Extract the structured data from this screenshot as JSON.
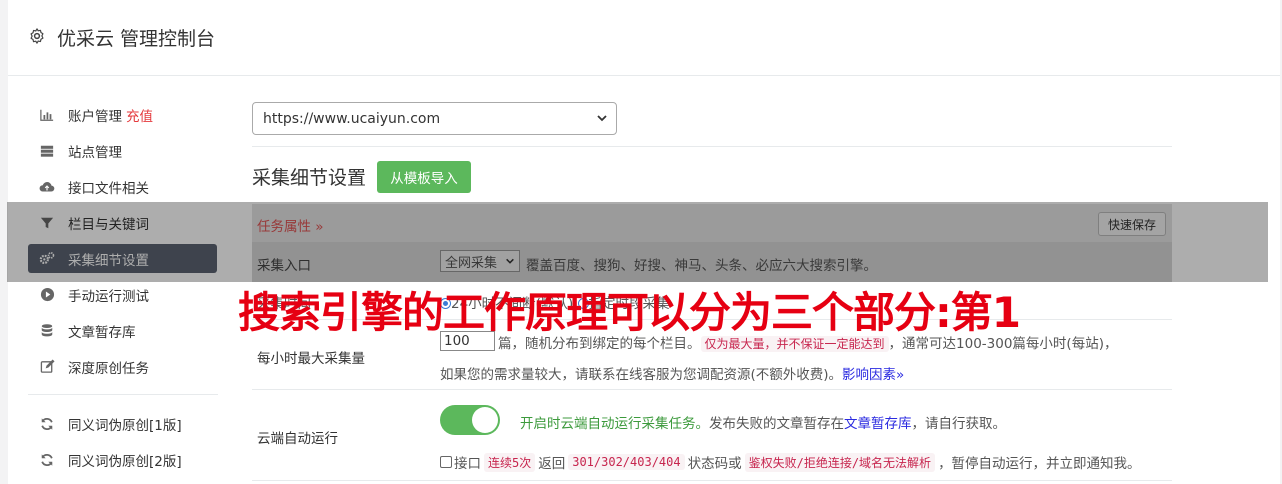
{
  "header": {
    "title": "优采云 管理控制台",
    "icon": "gear-icon"
  },
  "sidebar": {
    "items": [
      {
        "label": "账户管理",
        "badge": "充值",
        "icon": "bar-chart-icon"
      },
      {
        "label": "站点管理",
        "icon": "server-icon"
      },
      {
        "label": "接口文件相关",
        "icon": "cloud-upload-icon"
      },
      {
        "label": "栏目与关键词",
        "icon": "filter-icon"
      },
      {
        "label": "采集细节设置",
        "icon": "cogs-icon",
        "active": true
      },
      {
        "label": "手动运行测试",
        "icon": "play-circle-icon"
      },
      {
        "label": "文章暂存库",
        "icon": "database-icon"
      },
      {
        "label": "深度原创任务",
        "icon": "edit-icon"
      },
      {
        "label": "同义词伪原创[1版]",
        "icon": "refresh-icon"
      },
      {
        "label": "同义词伪原创[2版]",
        "icon": "refresh-icon"
      }
    ]
  },
  "site_select": {
    "value": "https://www.ucaiyun.com"
  },
  "section": {
    "title": "采集细节设置",
    "import_button": "从模板导入"
  },
  "task_table": {
    "header_label": "任务属性 »",
    "save_button": "快速保存",
    "entry": {
      "key": "采集入口",
      "select_value": "全网采集",
      "desc": "覆盖百度、搜狗、好搜、神马、头条、必应六大搜索引擎。"
    },
    "schedule": {
      "key": "采集时间",
      "option1": "24小时不间断(默认)",
      "option2": "指定时段采集"
    },
    "hourly": {
      "key": "每小时最大采集量",
      "value": "100",
      "text_a": "篇，随机分布到绑定的每个栏目。",
      "code_a": "仅为最大量，并不保证一定能达到",
      "text_b": "，通常可达100-300篇每小时(每站)，",
      "line2": "如果您的需求量较大，请联系在线客服为您调配资源(不额外收费)。",
      "link": "影响因素»"
    },
    "cloud": {
      "key": "云端自动运行",
      "toggle_on": true,
      "desc_green": "开启时云端自动运行采集任务。",
      "desc_a": "发布失败的文章暂存在",
      "desc_link": "文章暂存库",
      "desc_b": "，请自行获取。",
      "cb_label": "接口",
      "code1": "连续5次",
      "t1": "返回",
      "code2": "301/302/403/404",
      "t2": "状态码或",
      "code3": "鉴权失败/拒绝连接/域名无法解析",
      "t3": "，暂停自动运行，并立即通知我。"
    }
  },
  "overlay": {
    "text": "搜索引擎的工作原理可以分为三个部分:第1"
  },
  "colors": {
    "active_sidebar": "#5c6472",
    "green": "#5cb85c",
    "overlay_red": "#e60012",
    "dim_band": "rgba(0,0,0,0.32)"
  }
}
